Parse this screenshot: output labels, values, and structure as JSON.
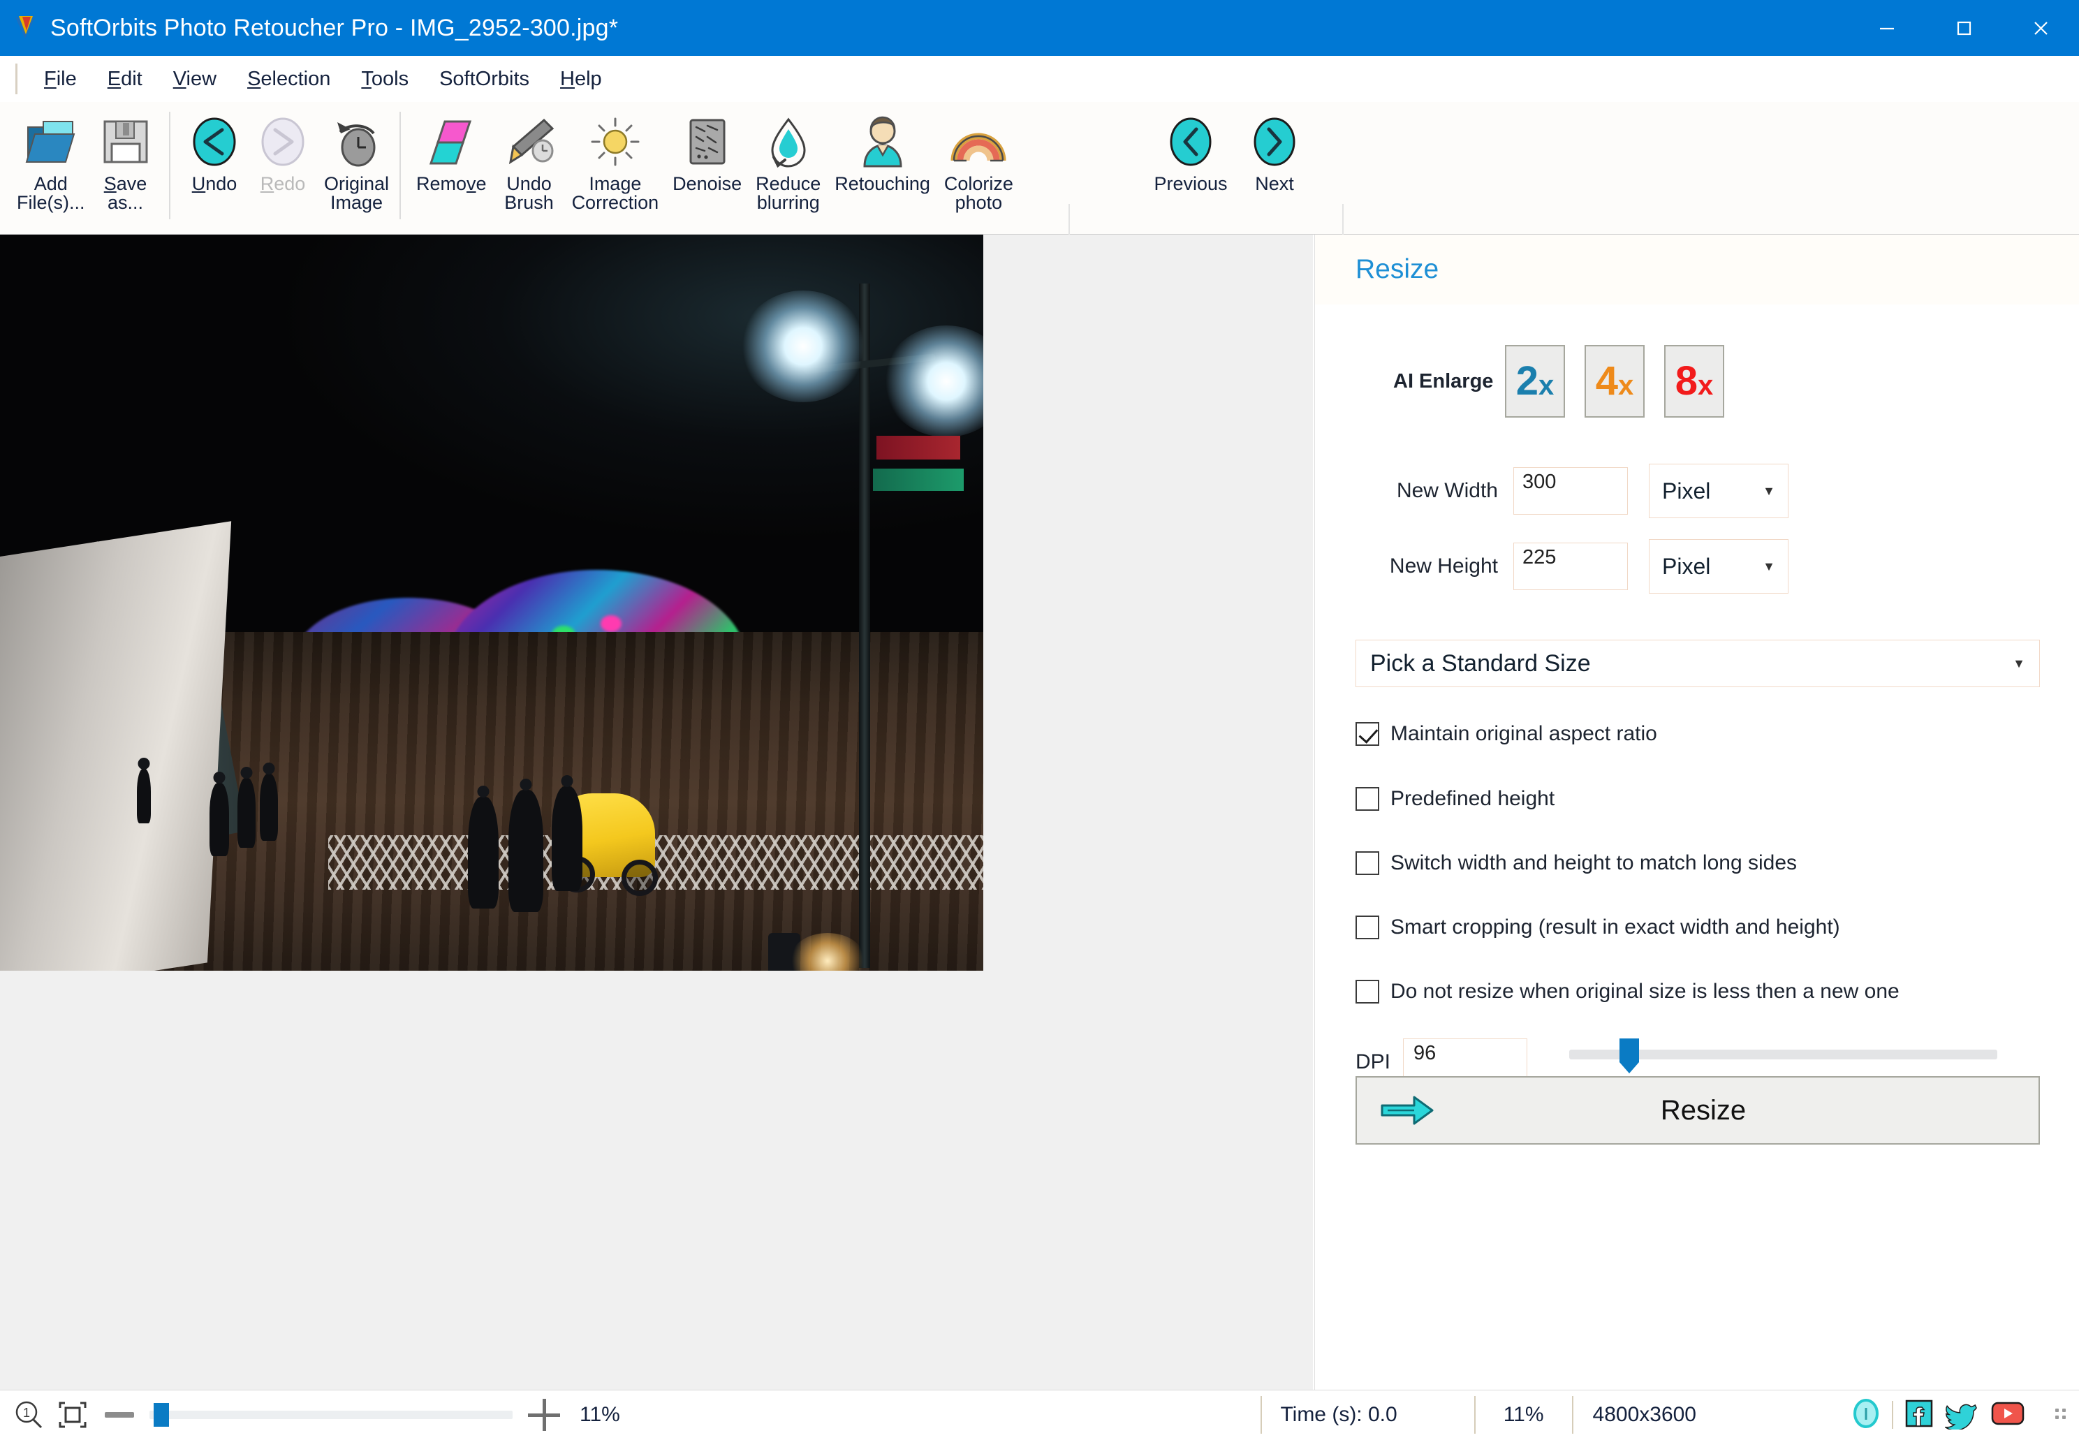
{
  "window": {
    "title": "SoftOrbits Photo Retoucher Pro - IMG_2952-300.jpg*",
    "app_icon": "softorbits-logo-icon",
    "minimize": "minimize-icon",
    "maximize": "maximize-icon",
    "close": "close-icon",
    "titlebar_color": "#0078d4"
  },
  "menubar": {
    "items": [
      {
        "label": "File",
        "mnemonic": "F"
      },
      {
        "label": "Edit",
        "mnemonic": "E"
      },
      {
        "label": "View",
        "mnemonic": "V"
      },
      {
        "label": "Selection",
        "mnemonic": "S"
      },
      {
        "label": "Tools",
        "mnemonic": "T"
      },
      {
        "label": "SoftOrbits",
        "mnemonic": ""
      },
      {
        "label": "Help",
        "mnemonic": "H"
      }
    ]
  },
  "toolbar": {
    "group1": [
      {
        "label": "Add\nFile(s)...",
        "icon": "open-folder-icon",
        "enabled": true
      },
      {
        "label": "Save\nas...",
        "icon": "floppy-disk-save-icon",
        "enabled": true
      }
    ],
    "group2": [
      {
        "label": "Undo",
        "icon": "undo-arrow-left-icon",
        "enabled": true
      },
      {
        "label": "Redo",
        "icon": "redo-arrow-right-icon",
        "enabled": false
      },
      {
        "label": "Original\nImage",
        "icon": "history-clock-icon",
        "enabled": true
      }
    ],
    "group3": [
      {
        "label": "Remove",
        "icon": "eraser-icon",
        "enabled": true
      },
      {
        "label": "Undo\nBrush",
        "icon": "brush-undo-icon",
        "enabled": true
      },
      {
        "label": "Image\nCorrection",
        "icon": "sun-brightness-icon",
        "enabled": true
      },
      {
        "label": "Denoise",
        "icon": "noise-grid-icon",
        "enabled": true
      },
      {
        "label": "Reduce\nblurring",
        "icon": "water-drop-icon",
        "enabled": true
      },
      {
        "label": "Retouching",
        "icon": "person-portrait-icon",
        "enabled": true
      },
      {
        "label": "Colorize\nphoto",
        "icon": "rainbow-arc-icon",
        "enabled": true
      }
    ],
    "group4": [
      {
        "label": "Previous",
        "icon": "chevron-left-circle-icon",
        "enabled": true
      },
      {
        "label": "Next",
        "icon": "chevron-right-circle-icon",
        "enabled": true
      }
    ],
    "overflow_icon": "toolbar-overflow-icon"
  },
  "panel": {
    "title": "Resize",
    "title_color": "#1e8fd5",
    "ai_enlarge": {
      "label": "AI Enlarge",
      "options": [
        {
          "label": "2",
          "suffix": "x",
          "color": "#1b7fad"
        },
        {
          "label": "4",
          "suffix": "x",
          "color": "#ee8a1a"
        },
        {
          "label": "8",
          "suffix": "x",
          "color": "#f21b1b"
        }
      ]
    },
    "new_width": {
      "label": "New Width",
      "value": "300",
      "unit": "Pixel"
    },
    "new_height": {
      "label": "New Height",
      "value": "225",
      "unit": "Pixel"
    },
    "standard_size": {
      "label": "Pick a Standard Size"
    },
    "checkboxes": [
      {
        "label": "Maintain original aspect ratio",
        "checked": true
      },
      {
        "label": "Predefined height",
        "checked": false
      },
      {
        "label": "Switch width and height to match long sides",
        "checked": false
      },
      {
        "label": "Smart cropping (result in exact width and height)",
        "checked": false
      },
      {
        "label": "Do not resize when original size is less then a new one",
        "checked": false
      }
    ],
    "dpi": {
      "label": "DPI",
      "value": "96",
      "slider_ticks": 7,
      "thumb_position_pct": 12
    },
    "resize_button": {
      "label": "Resize",
      "icon": "right-arrow-icon"
    }
  },
  "canvas": {
    "photo_alt": "Night boardwalk with illuminated multicolored dome canopy, street lamps, pedicab and pedestrians"
  },
  "statusbar": {
    "zoom_1to1_icon": "magnifier-one-to-one-icon",
    "fit_window_icon": "fit-to-window-icon",
    "zoom_out_icon": "zoom-out-minus-icon",
    "zoom_in_icon": "zoom-in-plus-icon",
    "zoom_value": "11%",
    "time_label": "Time (s): 0.0",
    "zoom_value_2": "11%",
    "dimensions": "4800x3600",
    "social": [
      {
        "name": "info-icon",
        "color": "#35d3d6"
      },
      {
        "name": "facebook-icon",
        "color": "#2fd2d8"
      },
      {
        "name": "twitter-icon",
        "color": "#2fd2d8"
      },
      {
        "name": "youtube-icon",
        "color": "#f0554b"
      }
    ],
    "resize_grip_icon": "resize-grip-icon"
  }
}
